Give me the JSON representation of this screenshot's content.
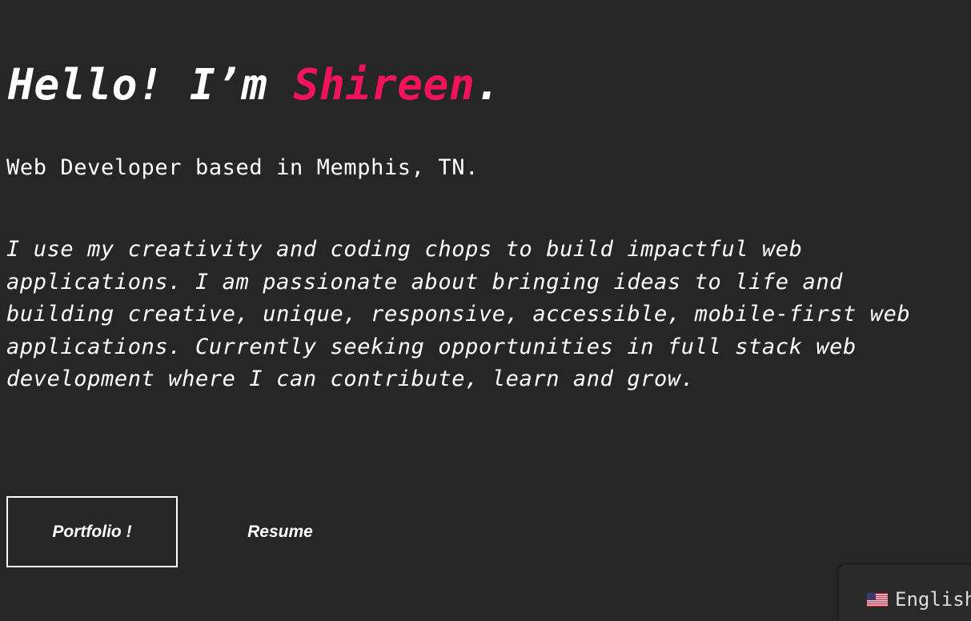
{
  "hero": {
    "greeting": "Hello! I’m ",
    "name": "Shireen",
    "greeting_end": ".",
    "subtitle": "Web Developer based in Memphis, TN.",
    "bio_lines": [
      "I use my creativity and coding chops to build impactful web",
      "applications. I am passionate about bringing ideas to life and",
      "building creative, unique, responsive, accessible, mobile-first web",
      "applications. Currently seeking opportunities in full stack web",
      "development where I can contribute, learn and grow."
    ]
  },
  "buttons": {
    "portfolio_label": "Portfolio !",
    "resume_label": "Resume"
  },
  "language_switcher": {
    "label": "English",
    "flag_icon": "us-flag-icon"
  },
  "colors": {
    "background": "#262626",
    "accent": "#f0145a",
    "text": "#ffffff"
  }
}
